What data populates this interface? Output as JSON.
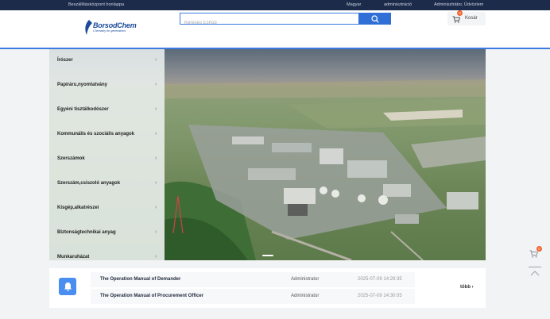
{
  "topbar": {
    "home_link": "Beszállításközpont honlappa",
    "language": "Magyar",
    "admin_link": "adminisztráció",
    "greeting": "Adminisztrátor,  Üdvözlem"
  },
  "header": {
    "logo_name": "BorsodChem",
    "logo_tagline": "Chemistry for generations",
    "search_placeholder": "Keresés Eshop",
    "cart_label": "Kosár",
    "cart_count": "0"
  },
  "categories": [
    "Írószer",
    "Papíráru,nyomtatvány",
    "Egyéni tisztálkodószer",
    "Kommunális és szociális anyagok",
    "Szerszámok",
    "Szerszám,csiszoló anyagok",
    "Kisgép,alkatrészei",
    "Biztonságtechnikai anyag",
    "Munkaruházat"
  ],
  "notices": [
    {
      "title": "The Operation Manual of Demander",
      "author": "Administrator",
      "time": "2025-07-09 14:29:35"
    },
    {
      "title": "The Operation Manual of Procurement Officer",
      "author": "Administrator",
      "time": "2025-07-09 14:30:05"
    }
  ],
  "more_label": "több",
  "float_cart_count": "0",
  "colors": {
    "accent": "#2f6fd6",
    "topbar": "#1c2b4a",
    "badge": "#f0642f"
  },
  "icons": [
    "search-icon",
    "cart-icon",
    "bell-icon",
    "chevron-right-icon",
    "back-to-top-icon"
  ]
}
